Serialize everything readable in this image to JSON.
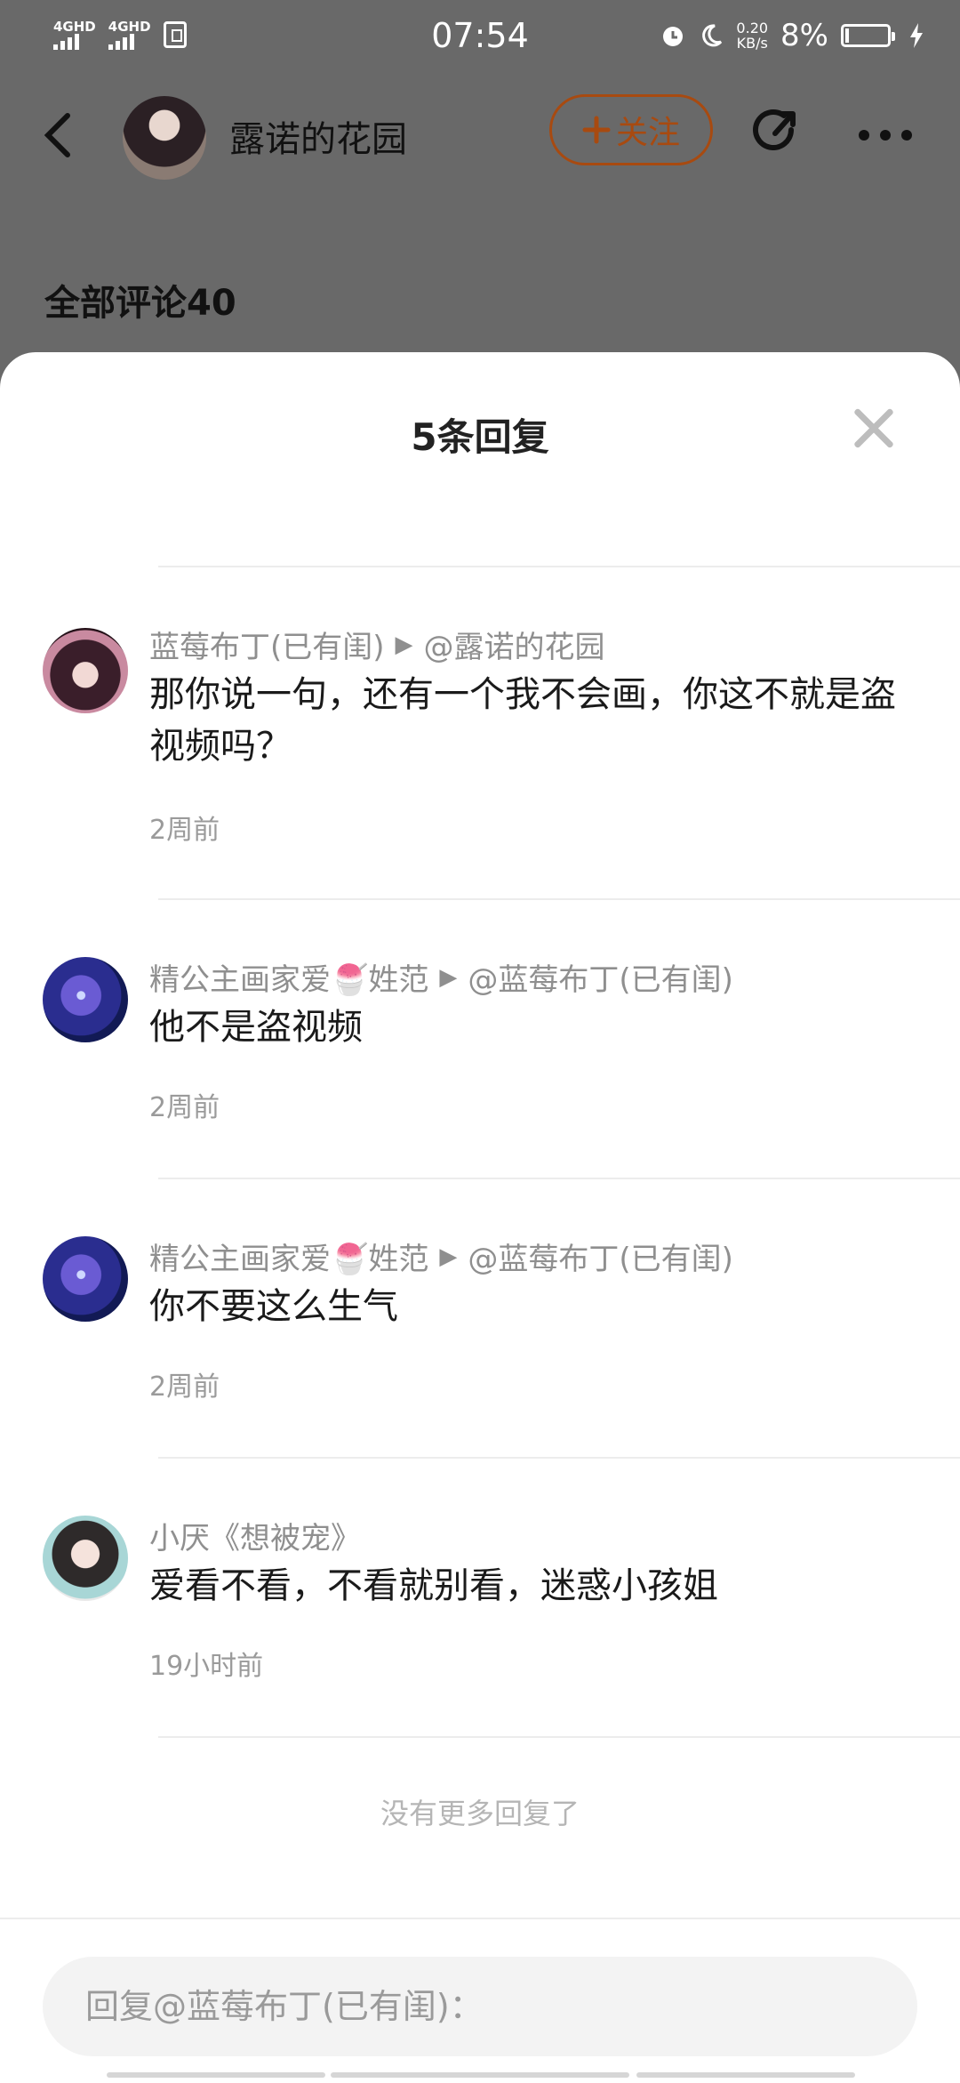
{
  "status_bar": {
    "signal1_label": "4GHD",
    "signal2_label": "4GHD",
    "time": "07:54",
    "speed_value": "0.20",
    "speed_unit": "KB/s",
    "battery": "8%"
  },
  "header": {
    "title": "露诺的花园",
    "follow_label": "关注"
  },
  "all_comments": "全部评论40",
  "sheet": {
    "title": "5条回复",
    "replies": [
      {
        "user": "蓝莓布丁(已有闺)",
        "reply_to": "@露诺的花园",
        "text": "那你说一句，还有一个我不会画，你这不就是盗视频吗？",
        "time": "2周前"
      },
      {
        "user": "精公主画家爱🍧姓范",
        "reply_to": "@蓝莓布丁(已有闺)",
        "text": "他不是盗视频",
        "time": "2周前"
      },
      {
        "user": "精公主画家爱🍧姓范",
        "reply_to": "@蓝莓布丁(已有闺)",
        "text": "你不要这么生气",
        "time": "2周前"
      },
      {
        "user": "小厌《想被宠》",
        "reply_to": "",
        "text": "爱看不看，不看就别看，迷惑小孩姐",
        "time": "19小时前"
      }
    ],
    "no_more": "没有更多回复了",
    "input_placeholder": "回复@蓝莓布丁(已有闺)："
  }
}
